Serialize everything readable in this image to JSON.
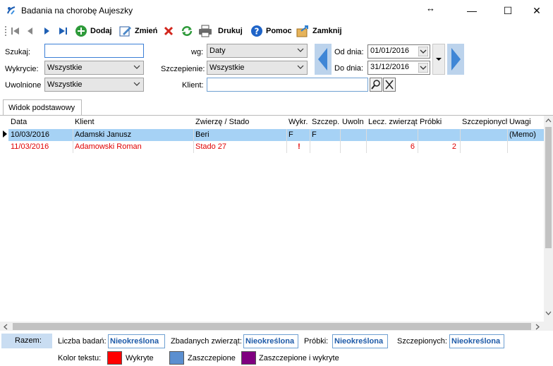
{
  "window": {
    "title": "Badania na chorobę Aujeszky",
    "resize_glyph": "↔",
    "min": "—",
    "max": "☐",
    "close": "✕"
  },
  "toolbar": {
    "add": "Dodaj",
    "edit": "Zmień",
    "print": "Drukuj",
    "help": "Pomoc",
    "close": "Zamknij"
  },
  "filters": {
    "search_label": "Szukaj:",
    "search_value": "",
    "detection_label": "Wykrycie:",
    "detection_value": "Wszystkie",
    "released_label": "Uwolnione",
    "released_value": "Wszystkie",
    "by_label": "wg:",
    "by_value": "Daty",
    "vaccination_label": "Szczepienie:",
    "vaccination_value": "Wszystkie",
    "client_label": "Klient:",
    "client_value": "",
    "from_label": "Od dnia:",
    "from_value": "01/01/2016",
    "to_label": "Do dnia:",
    "to_value": "31/12/2016"
  },
  "tab": {
    "label": "Widok podstawowy"
  },
  "grid": {
    "columns": [
      "Data",
      "Klient",
      "Zwierzę / Stado",
      "Wykr.",
      "Szczep.",
      "Uwoln",
      "Lecz. zwierząt",
      "Próbki",
      "Szczepionych",
      "Uwagi"
    ],
    "rows": [
      {
        "date": "10/03/2016",
        "client": "Adamski Janusz",
        "animal": "Beri",
        "detected": "F",
        "vaccinated": "F",
        "released": "",
        "treated": "",
        "samples": "",
        "vaccinated_count": "",
        "notes": "(Memo)"
      },
      {
        "date": "11/03/2016",
        "client": "Adamowski Roman",
        "animal": "Stado 27",
        "detected": "!",
        "vaccinated": "",
        "released": "",
        "treated": "6",
        "samples": "2",
        "vaccinated_count": "",
        "notes": ""
      }
    ]
  },
  "footer": {
    "total_label": "Razem:",
    "tests_label": "Liczba badań:",
    "tests_value": "Nieokreślona",
    "animals_label": "Zbadanych zwierząt:",
    "animals_value": "Nieokreślona",
    "samples_label": "Próbki:",
    "samples_value": "Nieokreślona",
    "vaccinated_label": "Szczepionych:",
    "vaccinated_value": "Nieokreślona",
    "color_label": "Kolor tekstu:",
    "legend_detected": "Wykryte",
    "legend_vaccinated": "Zaszczepione",
    "legend_both": "Zaszczepione i wykryte"
  },
  "colors": {
    "detected": "#ff0000",
    "vaccinated": "#5b8fd0",
    "both": "#800080",
    "selected_row": "#a6d2f5",
    "red_text": "#e00000"
  }
}
